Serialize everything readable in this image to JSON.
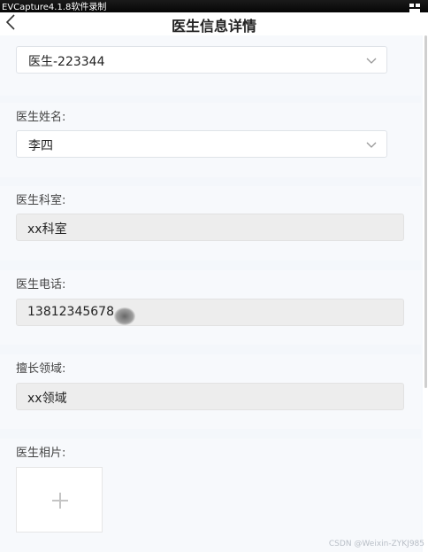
{
  "capture_bar": {
    "title": "EVCapture4.1.8软件录制"
  },
  "header": {
    "title": "医生信息详情"
  },
  "fields": {
    "doctor_id": {
      "value": "医生-223344"
    },
    "name": {
      "label": "医生姓名:",
      "value": "李四"
    },
    "department": {
      "label": "医生科室:",
      "value": "xx科室"
    },
    "phone": {
      "label": "医生电话:",
      "value": "13812345678"
    },
    "specialty": {
      "label": "擅长领域:",
      "value": "xx领域"
    },
    "photo": {
      "label": "医生相片:"
    }
  },
  "watermark": "CSDN @Weixin-ZYKJ985",
  "icons": {
    "back": "chevron-left-icon",
    "select_arrow": "chevron-down-icon",
    "upload": "plus-icon",
    "capture": "window-icon"
  }
}
